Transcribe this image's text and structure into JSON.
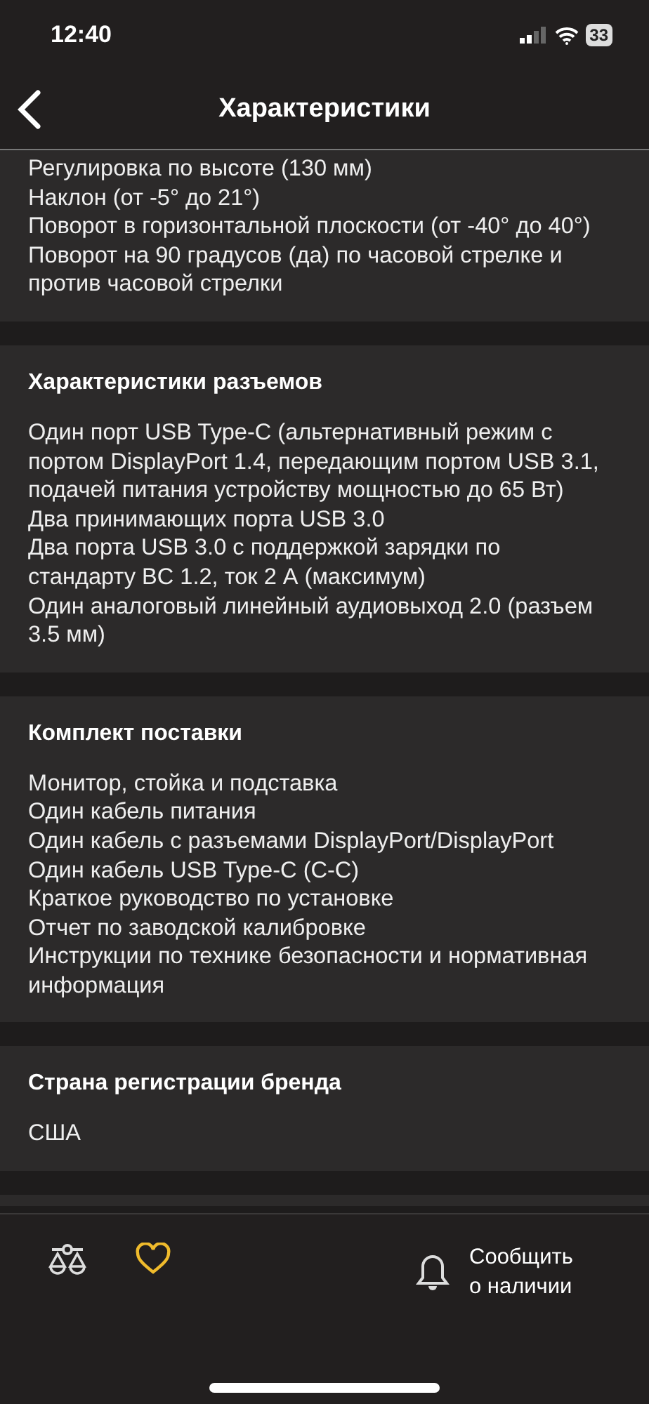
{
  "status_bar": {
    "time": "12:40",
    "battery": "33"
  },
  "header": {
    "title": "Характеристики"
  },
  "sections": [
    {
      "items": [
        "Регулировка по высоте (130 мм)",
        "Наклон (от -5° до 21°)",
        "Поворот в горизонтальной плоскости (от -40° до 40°)",
        "Поворот на 90 градусов (да) по часовой стрелке и против часовой стрелки"
      ]
    },
    {
      "title": "Характеристики разъемов",
      "items": [
        "Один порт USB Type-C (альтернативный режим с портом DisplayPort 1.4, передающим портом USB 3.1, подачей питания устройству мощностью до 65 Вт)",
        "Два принимающих порта USB 3.0",
        "Два порта USB 3.0 с поддержкой зарядки по стандарту BC 1.2, ток 2 А (максимум)",
        "Один аналоговый линейный аудиовыход 2.0 (разъем 3.5 мм)"
      ]
    },
    {
      "title": "Комплект поставки",
      "items": [
        "Монитор, стойка и подставка",
        "Один кабель питания",
        "Один кабель с разъемами DisplayPort/DisplayPort",
        "Один кабель USB Type-C (C-C)",
        "Краткое руководство по установке",
        "Отчет по заводской калибровке",
        "Инструкции по технике безопасности и нормативная информация"
      ]
    },
    {
      "title": "Страна регистрации бренда",
      "items": [
        "США"
      ]
    }
  ],
  "bottom_bar": {
    "favorite": {
      "selected": true
    },
    "notify_label": "Сообщить о наличии"
  }
}
